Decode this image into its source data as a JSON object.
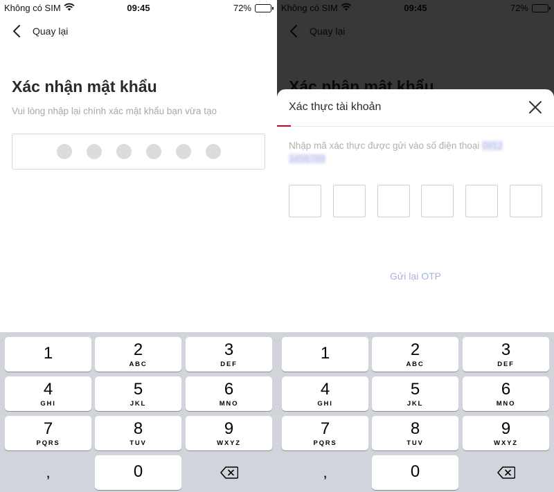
{
  "status_bar": {
    "carrier": "Không có SIM",
    "time": "09:45",
    "battery": "72%",
    "battery_level": 0.72
  },
  "nav": {
    "back_label": "Quay lại"
  },
  "confirm_password": {
    "title": "Xác nhận mật khẩu",
    "subtitle": "Vui lòng nhập lại chính xác mật khẩu bạn vừa tạo",
    "digits_entered": 6
  },
  "verify_sheet": {
    "title": "Xác thực tài khoản",
    "description": "Nhập mã xác thực được gửi vào số điện thoại",
    "phone_hidden": "0912 3456789",
    "otp_length": 6,
    "resend_label": "Gửi lại OTP",
    "accent_color": "#d0021b"
  },
  "keyboard": {
    "keys": [
      {
        "digit": "1",
        "letters": ""
      },
      {
        "digit": "2",
        "letters": "ABC"
      },
      {
        "digit": "3",
        "letters": "DEF"
      },
      {
        "digit": "4",
        "letters": "GHI"
      },
      {
        "digit": "5",
        "letters": "JKL"
      },
      {
        "digit": "6",
        "letters": "MNO"
      },
      {
        "digit": "7",
        "letters": "PQRS"
      },
      {
        "digit": "8",
        "letters": "TUV"
      },
      {
        "digit": "9",
        "letters": "WXYZ"
      }
    ],
    "comma": ",",
    "zero": "0"
  }
}
